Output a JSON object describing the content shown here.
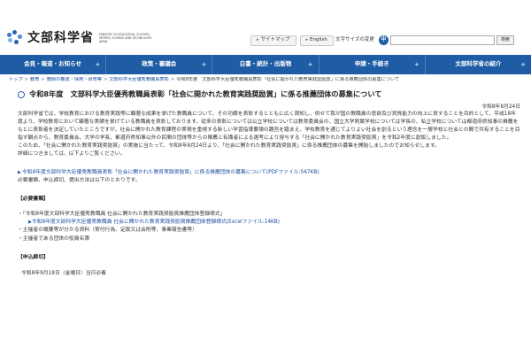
{
  "header": {
    "logo_text": "文部科学省",
    "logo_en": "MINISTRY OF EDUCATION, CULTURE, SPORTS, SCIENCE AND TECHNOLOGY-JAPAN",
    "sitemap_label": "サイトマップ",
    "english_label": "English",
    "fontsize_label": "文字サイズの変更",
    "fontsize_mid": "中",
    "fontsize_big": "大",
    "search_button": "検索",
    "search_value": ""
  },
  "nav": [
    {
      "label": "会見・報道・お知らせ"
    },
    {
      "label": "政策・審議会"
    },
    {
      "label": "白書・統計・出版物"
    },
    {
      "label": "申請・手続き"
    },
    {
      "label": "文部科学省の紹介"
    }
  ],
  "breadcrumb": [
    "トップ",
    "教育",
    "教師の養成・採用・研修等",
    "文部科学大臣優秀教職員表彰",
    "令和8年度　文部科学大臣優秀教職員表彰「社会に開かれた教育実践奨励賞」に係る推薦団体の募集について"
  ],
  "page": {
    "title": "令和8年度　文部科学大臣優秀教職員表彰「社会に開かれた教育実践奨励賞」に係る推薦団体の募集について",
    "date": "令和8年8月24日",
    "para1": "文部科学省では、学校教育における教育実践等に顕著な成果を挙げた教職員について、その功績を表彰するとともに広く周知し、併せて我が国の教職員の意欲及び資質能力の向上に資することを目的として、平成18年度より、学校教育において顕著な実績を挙げている教職員を表彰しております。従来の表彰については公立学校については教育委員会の、国立大学附属学校については学長の、私立学校については都道府県知事の推薦をもとに表彰者を決定していたところですが、社会に開かれた教育課程の実現を重視する新しい学習指導要領の趣旨を踏まえ、学校教育を通じてよりよい社会を創るという理念を一層学校と社会との間で共有することを目指す観点から、教育委員会、大学の学長、都道府県知事以外の民間の団体等からの推薦と有識者による選考により授与する「社会に開かれた教育実践奨励賞」を令和2年度に創設しました。",
    "para2": "このため、「社会に開かれた教育実践奨励賞」の実施に当たって、令和8年8月24日より、「社会に開かれた教育実践奨励賞」に係る推薦団体の募集を開始しましたのでお知らせします。",
    "para3": "詳細につきましては、以下よりご覧ください。",
    "link1": "令和8年度文部科学大臣優秀教職員表彰「社会に開かれた教育実践奨励賞」に係る推薦団体の募集について(PDFファイル:567KB)",
    "para4": "必要書類、申込締切、提出方法は以下のとおりです。",
    "section1": "【必要書類】",
    "doc1": "・「令和8年度文部科学大臣優秀教職員 社会に開かれた教育実践奨励賞推薦団体登録様式」",
    "doc1_link": "令和8年度文部科学大臣優秀教職員 社会に開かれた教育実践奨励賞推薦団体登録様式(Excelファイル:14KB)",
    "doc2": "・主催者の概要等が分かる資料（寄付行為、定款又は会則等、事業報告書等）",
    "doc3": "・主催者である団体の役員名簿",
    "section2": "【申込締切】",
    "deadline": "令和8年9月18日（金曜日）当日必着"
  },
  "colors": {
    "nav_bg": "#1e5ca5",
    "link": "#1a4fa0"
  }
}
